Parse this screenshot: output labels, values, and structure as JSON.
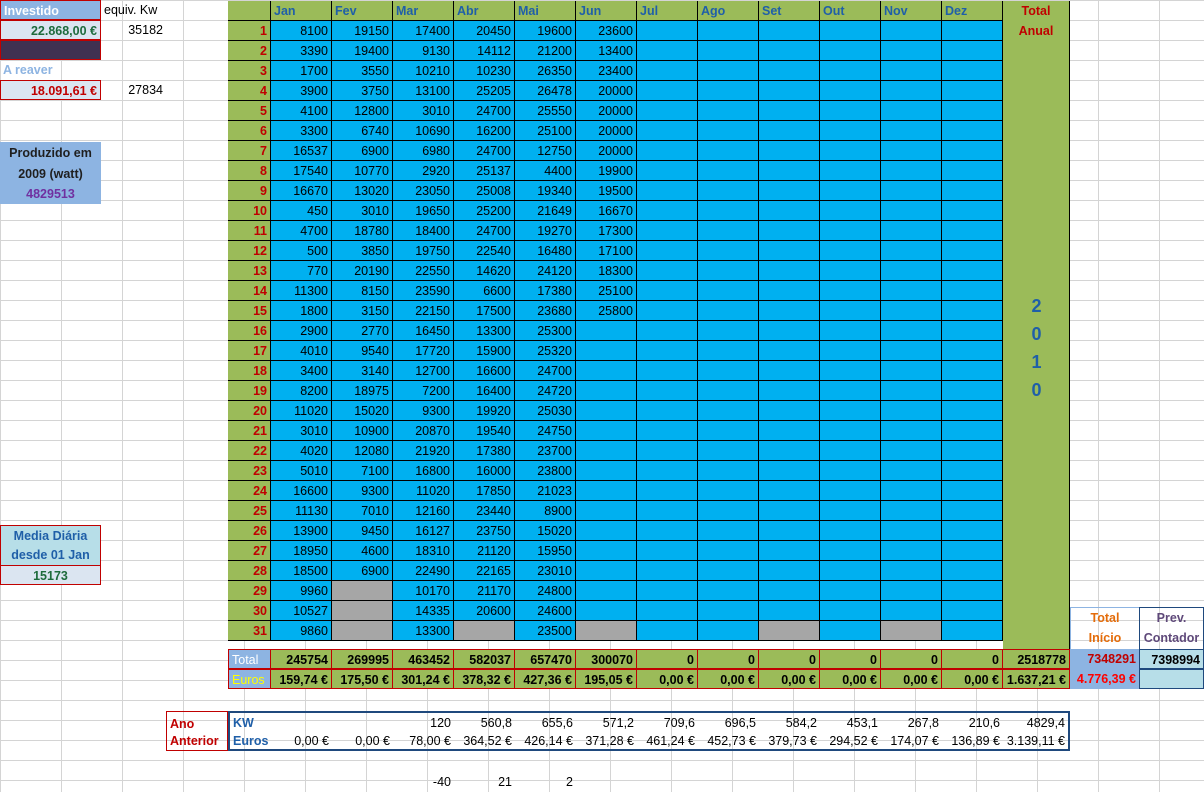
{
  "left": {
    "investido_label": "Investido",
    "investido_value": "22.868,00 €",
    "equiv_label": "equiv. Kw",
    "equiv_value_1": "35182",
    "a_reaver_label": "A reaver",
    "a_reaver_value": "18.091,61 €",
    "equiv_value_2": "27834",
    "produzido_line1": "Produzido em",
    "produzido_line2": "2009 (watt)",
    "produzido_value": "4829513",
    "media_line1": "Media Diária",
    "media_line2": "desde 01 Jan",
    "media_value": "15173"
  },
  "months": [
    "Jan",
    "Fev",
    "Mar",
    "Abr",
    "Mai",
    "Jun",
    "Jul",
    "Ago",
    "Set",
    "Out",
    "Nov",
    "Dez"
  ],
  "total_anual_line1": "Total",
  "total_anual_line2": "Anual",
  "year_digits": [
    "2",
    "0",
    "1",
    "0"
  ],
  "days": [
    [
      "8100",
      "19150",
      "17400",
      "20450",
      "19600",
      "23600"
    ],
    [
      "3390",
      "19400",
      "9130",
      "14112",
      "21200",
      "13400"
    ],
    [
      "1700",
      "3550",
      "10210",
      "10230",
      "26350",
      "23400"
    ],
    [
      "3900",
      "3750",
      "13100",
      "25205",
      "26478",
      "20000"
    ],
    [
      "4100",
      "12800",
      "3010",
      "24700",
      "25550",
      "20000"
    ],
    [
      "3300",
      "6740",
      "10690",
      "16200",
      "25100",
      "20000"
    ],
    [
      "16537",
      "6900",
      "6980",
      "24700",
      "12750",
      "20000"
    ],
    [
      "17540",
      "10770",
      "2920",
      "25137",
      "4400",
      "19900"
    ],
    [
      "16670",
      "13020",
      "23050",
      "25008",
      "19340",
      "19500"
    ],
    [
      "450",
      "3010",
      "19650",
      "25200",
      "21649",
      "16670"
    ],
    [
      "4700",
      "18780",
      "18400",
      "24700",
      "19270",
      "17300"
    ],
    [
      "500",
      "3850",
      "19750",
      "22540",
      "16480",
      "17100"
    ],
    [
      "770",
      "20190",
      "22550",
      "14620",
      "24120",
      "18300"
    ],
    [
      "11300",
      "8150",
      "23590",
      "6600",
      "17380",
      "25100"
    ],
    [
      "1800",
      "3150",
      "22150",
      "17500",
      "23680",
      "25800"
    ],
    [
      "2900",
      "2770",
      "16450",
      "13300",
      "25300",
      ""
    ],
    [
      "4010",
      "9540",
      "17720",
      "15900",
      "25320",
      ""
    ],
    [
      "3400",
      "3140",
      "12700",
      "16600",
      "24700",
      ""
    ],
    [
      "8200",
      "18975",
      "7200",
      "16400",
      "24720",
      ""
    ],
    [
      "11020",
      "15020",
      "9300",
      "19920",
      "25030",
      ""
    ],
    [
      "3010",
      "10900",
      "20870",
      "19540",
      "24750",
      ""
    ],
    [
      "4020",
      "12080",
      "21920",
      "17380",
      "23700",
      ""
    ],
    [
      "5010",
      "7100",
      "16800",
      "16000",
      "23800",
      ""
    ],
    [
      "16600",
      "9300",
      "11020",
      "17850",
      "21023",
      ""
    ],
    [
      "11130",
      "7010",
      "12160",
      "23440",
      "8900",
      ""
    ],
    [
      "13900",
      "9450",
      "16127",
      "23750",
      "15020",
      ""
    ],
    [
      "18950",
      "4600",
      "18310",
      "21120",
      "15950",
      ""
    ],
    [
      "18500",
      "6900",
      "22490",
      "22165",
      "23010",
      ""
    ],
    [
      "9960",
      "",
      "10170",
      "21170",
      "24800",
      ""
    ],
    [
      "10527",
      "",
      "14335",
      "20600",
      "24600",
      ""
    ],
    [
      "9860",
      "",
      "13300",
      "",
      "23500",
      ""
    ]
  ],
  "totals": {
    "label": "Total",
    "values": [
      "245754",
      "269995",
      "463452",
      "582037",
      "657470",
      "300070",
      "0",
      "0",
      "0",
      "0",
      "0",
      "0"
    ],
    "annual": "2518778"
  },
  "euros": {
    "label": "Euros",
    "values": [
      "159,74 €",
      "175,50 €",
      "301,24 €",
      "378,32 €",
      "427,36 €",
      "195,05 €",
      "0,00 €",
      "0,00 €",
      "0,00 €",
      "0,00 €",
      "0,00 €",
      "0,00 €"
    ],
    "annual": "1.637,21 €"
  },
  "right": {
    "total_inicio_line1": "Total",
    "total_inicio_line2": "Início",
    "total_inicio_value": "7348291",
    "total_inicio_euros": "4.776,39 €",
    "prev_line1": "Prev.",
    "prev_line2": "Contador",
    "prev_value": "7398994"
  },
  "ano_anterior": {
    "line1": "Ano",
    "line2": "Anterior",
    "kw_label": "KW",
    "euros_label": "Euros",
    "kw": [
      "",
      "",
      "120",
      "560,8",
      "655,6",
      "571,2",
      "709,6",
      "696,5",
      "584,2",
      "453,1",
      "267,8",
      "210,6"
    ],
    "kw_total": "4829,4",
    "euros_values": [
      "0,00 €",
      "0,00 €",
      "78,00 €",
      "364,52 €",
      "426,14 €",
      "371,28 €",
      "461,24 €",
      "452,73 €",
      "379,73 €",
      "294,52 €",
      "174,07 €",
      "136,89 €"
    ],
    "euros_total": "3.139,11 €"
  },
  "diffs": [
    "-40",
    "21",
    "2"
  ]
}
